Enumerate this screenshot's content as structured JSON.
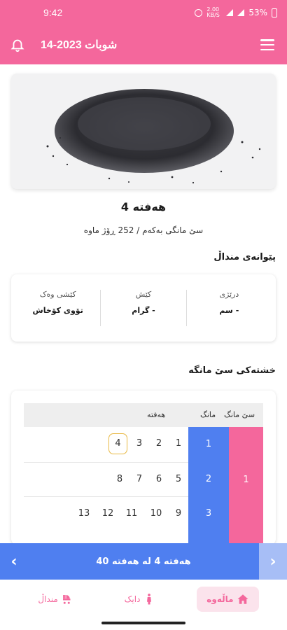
{
  "status_bar": {
    "time": "9:42",
    "battery": "53%",
    "network_speed": "2.00 KB/S"
  },
  "header": {
    "title": "14-2023 شوبات"
  },
  "hero": {
    "image": "poppy-seeds-pile"
  },
  "week": {
    "title": "هەفتە 4",
    "age": "سێ مانگی بەکەم / 252 ڕۆژ ماوە"
  },
  "measurements": {
    "section_title": "پێوانەی منداڵ",
    "items": [
      {
        "label": "درێژی",
        "value": "- سم"
      },
      {
        "label": "کێش",
        "value": "- گرام"
      },
      {
        "label": "کێشی وەک",
        "value": "تۆوی کۆخاش"
      }
    ]
  },
  "calendar": {
    "section_title": "خشتەکی سێ مانگە",
    "headers": {
      "trimester": "سێ مانگ",
      "month": "مانگ",
      "week": "هەفتە"
    },
    "trimester": "1",
    "months": [
      "1",
      "2",
      "3"
    ],
    "rows": [
      [
        "1",
        "2",
        "3",
        "4"
      ],
      [
        "5",
        "6",
        "7",
        "8"
      ],
      [
        "9",
        "10",
        "11",
        "12",
        "13"
      ]
    ],
    "active_week": "4"
  },
  "week_nav": {
    "label": "هەفتە 4 لە هەفتە 40",
    "prev": "‹",
    "next": "›"
  },
  "bottom_nav": {
    "home": "ماڵەوە",
    "mother": "دایک",
    "baby": "منداڵ"
  },
  "colors": {
    "primary": "#f4679c",
    "blue": "#4f7ff0",
    "active_border": "#e8b842"
  }
}
